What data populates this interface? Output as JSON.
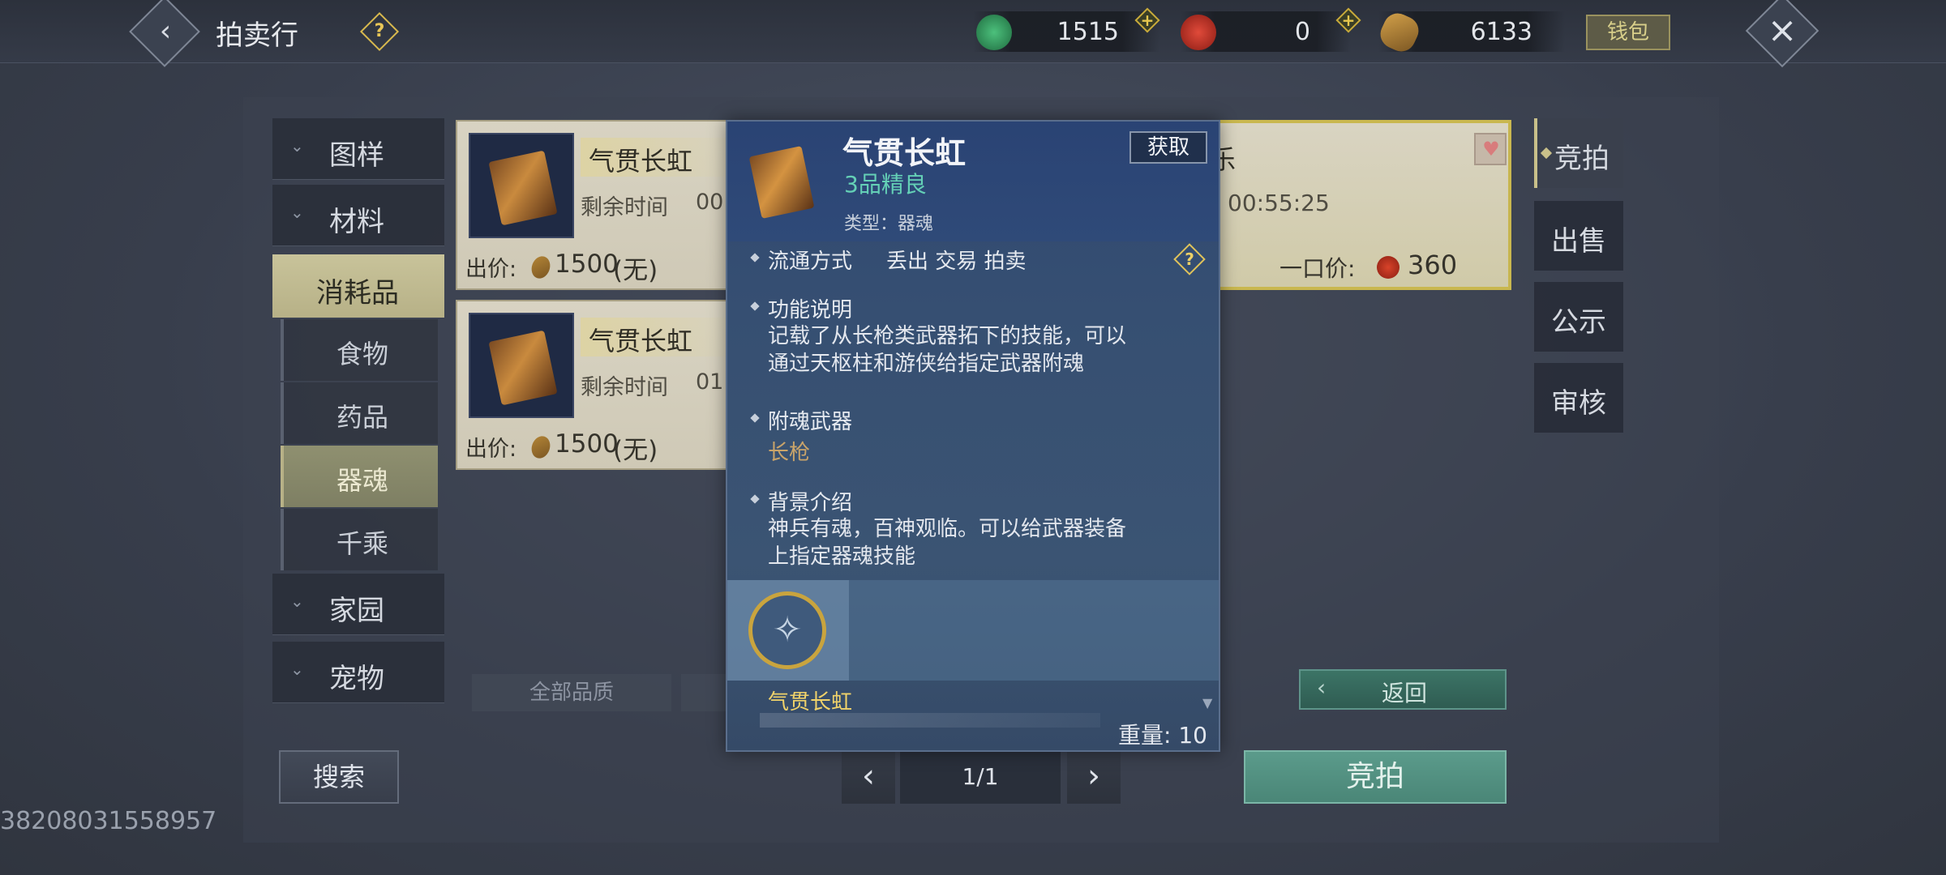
{
  "header": {
    "title": "拍卖行",
    "currencies": [
      {
        "icon": "jade-icon",
        "value": "1515",
        "color": "#2f9a5c"
      },
      {
        "icon": "red-coin-icon",
        "value": "0",
        "color": "#c7352a"
      },
      {
        "icon": "copper-coin-icon",
        "value": "6133",
        "color": "#b68a3c"
      }
    ],
    "wallet_label": "钱包"
  },
  "categories": {
    "top": [
      {
        "label": "图样"
      },
      {
        "label": "材料"
      }
    ],
    "active": {
      "label": "消耗品"
    },
    "sub": [
      {
        "label": "食物"
      },
      {
        "label": "药品"
      },
      {
        "label": "器魂"
      },
      {
        "label": "千乘"
      }
    ],
    "bottom": [
      {
        "label": "家园"
      },
      {
        "label": "宠物"
      }
    ]
  },
  "listings": [
    {
      "name": "气贯长虹",
      "time_label": "剩余时间",
      "time_value": "00",
      "price_label": "出价:",
      "price": "1500",
      "price_note": "(无)"
    },
    {
      "name": "气贯长虹",
      "time_label": "剩余时间",
      "time_value": "01",
      "price_label": "出价:",
      "price": "1500",
      "price_note": "(无)"
    },
    {
      "name_tail": "乐",
      "time_value": "00:55:25",
      "buyout_label": "一口价:",
      "buyout": "360"
    }
  ],
  "right_tabs": [
    {
      "label": "竞拍"
    },
    {
      "label": "出售"
    },
    {
      "label": "公示"
    },
    {
      "label": "审核"
    }
  ],
  "filters": {
    "quality": "全部品质"
  },
  "bottom": {
    "search_label": "搜索",
    "page": "1/1",
    "back_label": "返回",
    "bid_label": "竞拍",
    "uid": "38208031558957"
  },
  "tooltip": {
    "name": "气贯长虹",
    "grade": "3品精良",
    "type": "类型：器魂",
    "get_label": "获取",
    "trade_title": "流通方式",
    "trade_value": "丢出 交易 拍卖",
    "func_title": "功能说明",
    "func_line1": "记载了从长枪类武器拓下的技能，可以",
    "func_line2": "通过天枢柱和游侠给指定武器附魂",
    "weapon_title": "附魂武器",
    "weapon_value": "长枪",
    "bg_title": "背景介绍",
    "bg_line1": "神兵有魂，百神观临。可以给武器装备",
    "bg_line2": "上指定器魂技能",
    "footer_name": "气贯长虹",
    "weight": "重量: 10"
  }
}
